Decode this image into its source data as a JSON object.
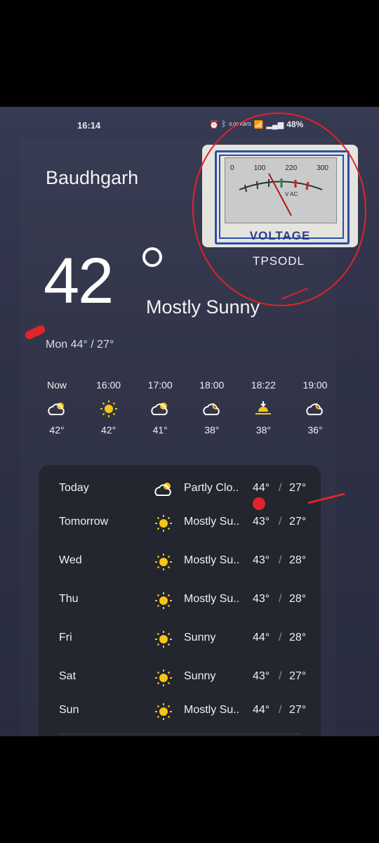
{
  "status": {
    "time": "16:14",
    "icons": [
      "alarm-icon",
      "bluetooth-icon",
      "data-speed-icon",
      "4g-signal-icon",
      "signal-icon"
    ],
    "data_speed": "0.00 KB/S",
    "battery": "48%"
  },
  "location": {
    "city": "Baudhgarh"
  },
  "current": {
    "temp": "42",
    "condition": "Mostly Sunny",
    "minmax": "Mon 44° / 27°"
  },
  "overlay_image": {
    "scale_labels": [
      "0",
      "100",
      "220",
      "300"
    ],
    "unit": "V AC",
    "label": "VOLTAGE",
    "caption": "TPSODL"
  },
  "hourly": [
    {
      "time": "Now",
      "icon": "partly-cloudy-icon",
      "temp": "42°"
    },
    {
      "time": "16:00",
      "icon": "sun-icon",
      "temp": "42°"
    },
    {
      "time": "17:00",
      "icon": "partly-cloudy-icon",
      "temp": "41°"
    },
    {
      "time": "18:00",
      "icon": "partly-cloudy-night-icon",
      "temp": "38°"
    },
    {
      "time": "18:22",
      "icon": "sunset-icon",
      "temp": "38°"
    },
    {
      "time": "19:00",
      "icon": "partly-cloudy-night-icon",
      "temp": "36°"
    }
  ],
  "daily": [
    {
      "day": "Today",
      "icon": "partly-cloudy-icon",
      "condition": "Partly Clo..",
      "hi": "44°",
      "lo": "27°"
    },
    {
      "day": "Tomorrow",
      "icon": "sun-icon",
      "condition": "Mostly Su..",
      "hi": "43°",
      "lo": "27°"
    },
    {
      "day": "Wed",
      "icon": "sun-icon",
      "condition": "Mostly Su..",
      "hi": "43°",
      "lo": "28°"
    },
    {
      "day": "Thu",
      "icon": "sun-icon",
      "condition": "Mostly Su..",
      "hi": "43°",
      "lo": "28°"
    },
    {
      "day": "Fri",
      "icon": "sun-icon",
      "condition": "Sunny",
      "hi": "44°",
      "lo": "28°"
    },
    {
      "day": "Sat",
      "icon": "sun-icon",
      "condition": "Sunny",
      "hi": "43°",
      "lo": "27°"
    },
    {
      "day": "Sun",
      "icon": "sun-icon",
      "condition": "Mostly Su..",
      "hi": "44°",
      "lo": "27°"
    }
  ],
  "colors": {
    "background": "#2f3247",
    "card": "#23252f",
    "sun": "#f5c518",
    "annotation": "#e0242a",
    "voltage_blue": "#2b3f8f"
  }
}
